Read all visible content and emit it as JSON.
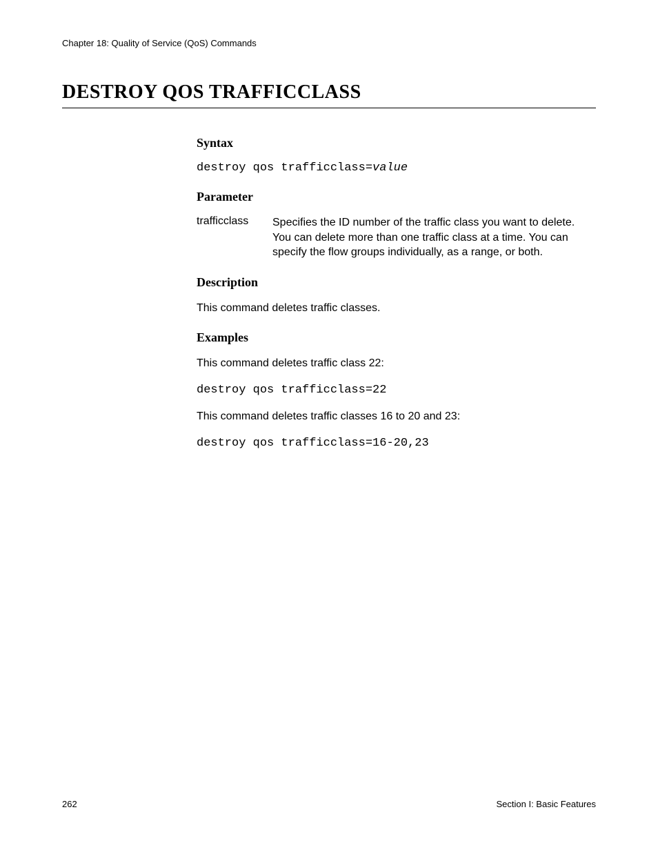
{
  "header": {
    "chapter": "Chapter 18: Quality of Service (QoS) Commands"
  },
  "title": "DESTROY QOS TRAFFICCLASS",
  "sections": {
    "syntax": {
      "heading": "Syntax",
      "command": "destroy qos trafficclass=",
      "value": "value"
    },
    "parameter": {
      "heading": "Parameter",
      "name": "trafficclass",
      "description": "Specifies the ID number of the traffic class you want to delete. You can delete more than one traffic class at a time. You can specify the flow groups individually, as a range, or both."
    },
    "description": {
      "heading": "Description",
      "text": "This command deletes traffic classes."
    },
    "examples": {
      "heading": "Examples",
      "intro1": "This command deletes traffic class 22:",
      "code1": "destroy qos trafficclass=22",
      "intro2": "This command deletes traffic classes 16 to 20 and 23:",
      "code2": "destroy qos trafficclass=16-20,23"
    }
  },
  "footer": {
    "pageNumber": "262",
    "section": "Section I: Basic Features"
  }
}
